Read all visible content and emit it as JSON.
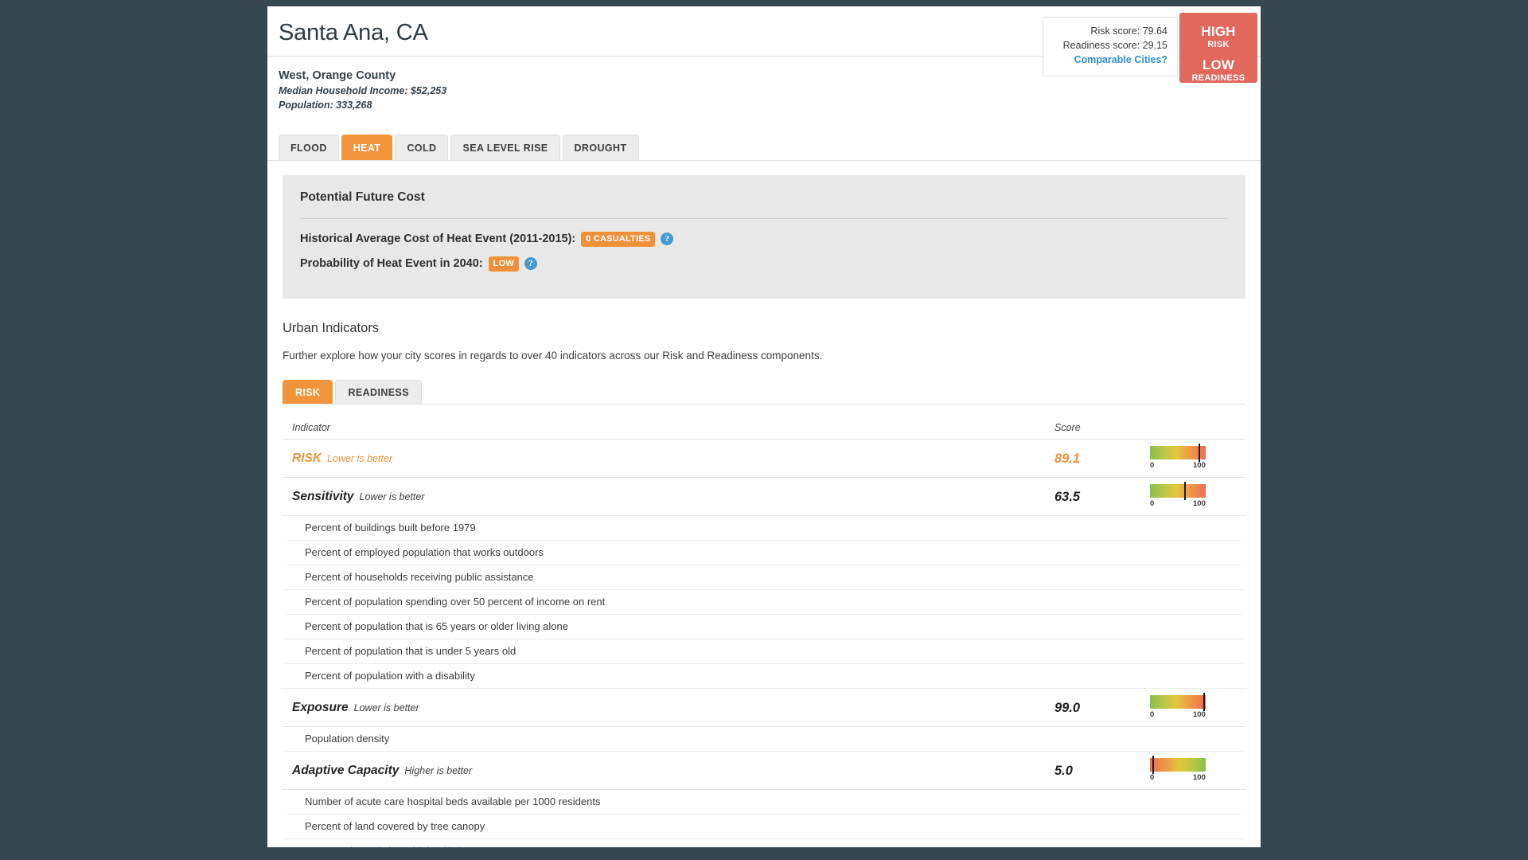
{
  "city": {
    "name": "Santa Ana, CA",
    "region": "West, Orange County",
    "median_income": "Median Household Income: $52,253",
    "population": "Population: 333,268"
  },
  "score_card": {
    "risk_score": "Risk score: 79.64",
    "readiness_score": "Readiness score: 29.15",
    "comparable_link": "Comparable Cities?",
    "link_color": "#2f8dd6"
  },
  "risk_badge": {
    "risk_level": "HIGH",
    "risk_label": "RISK",
    "readiness_level": "LOW",
    "readiness_label": "READINESS",
    "background": "#e2675c"
  },
  "hazard_tabs": [
    {
      "label": "FLOOD",
      "active": false
    },
    {
      "label": "HEAT",
      "active": true
    },
    {
      "label": "COLD",
      "active": false
    },
    {
      "label": "SEA LEVEL RISE",
      "active": false
    },
    {
      "label": "DROUGHT",
      "active": false
    }
  ],
  "future_cost": {
    "title": "Potential Future Cost",
    "historical_label": "Historical Average Cost of Heat Event (2011-2015):",
    "historical_value": "0 CASUALTIES",
    "probability_label": "Probability of Heat Event in 2040:",
    "probability_value": "LOW",
    "help_glyph": "?",
    "pill_color": "#f0913a"
  },
  "urban_indicators": {
    "title": "Urban Indicators",
    "description": "Further explore how your city scores in regards to over 40 indicators across our Risk and Readiness components.",
    "tabs": [
      {
        "label": "RISK",
        "active": true
      },
      {
        "label": "READINESS",
        "active": false
      }
    ],
    "columns": {
      "indicator": "Indicator",
      "score": "Score"
    },
    "gauge_scale": {
      "min": "0",
      "max": "100"
    },
    "accent_color": "#f0913a",
    "rows": [
      {
        "name": "RISK",
        "hint": "Lower is better",
        "score": "89.1",
        "score_value": 89.1,
        "accent": true,
        "gauge_reversed": false,
        "children": []
      },
      {
        "name": "Sensitivity",
        "hint": "Lower is better",
        "score": "63.5",
        "score_value": 63.5,
        "accent": false,
        "gauge_reversed": false,
        "children": [
          "Percent of buildings built before 1979",
          "Percent of employed population that works outdoors",
          "Percent of households receiving public assistance",
          "Percent of population spending over 50 percent of income on rent",
          "Percent of population that is 65 years or older living alone",
          "Percent of population that is under 5 years old",
          "Percent of population with a disability"
        ]
      },
      {
        "name": "Exposure",
        "hint": "Lower is better",
        "score": "99.0",
        "score_value": 99.0,
        "accent": false,
        "gauge_reversed": false,
        "children": [
          "Population density"
        ]
      },
      {
        "name": "Adaptive Capacity",
        "hint": "Higher is better",
        "score": "5.0",
        "score_value": 5.0,
        "accent": false,
        "gauge_reversed": true,
        "children": [
          "Number of acute care hospital beds available per 1000 residents",
          "Percent of land covered by tree canopy",
          "Percent of population with health insurance"
        ]
      }
    ]
  }
}
